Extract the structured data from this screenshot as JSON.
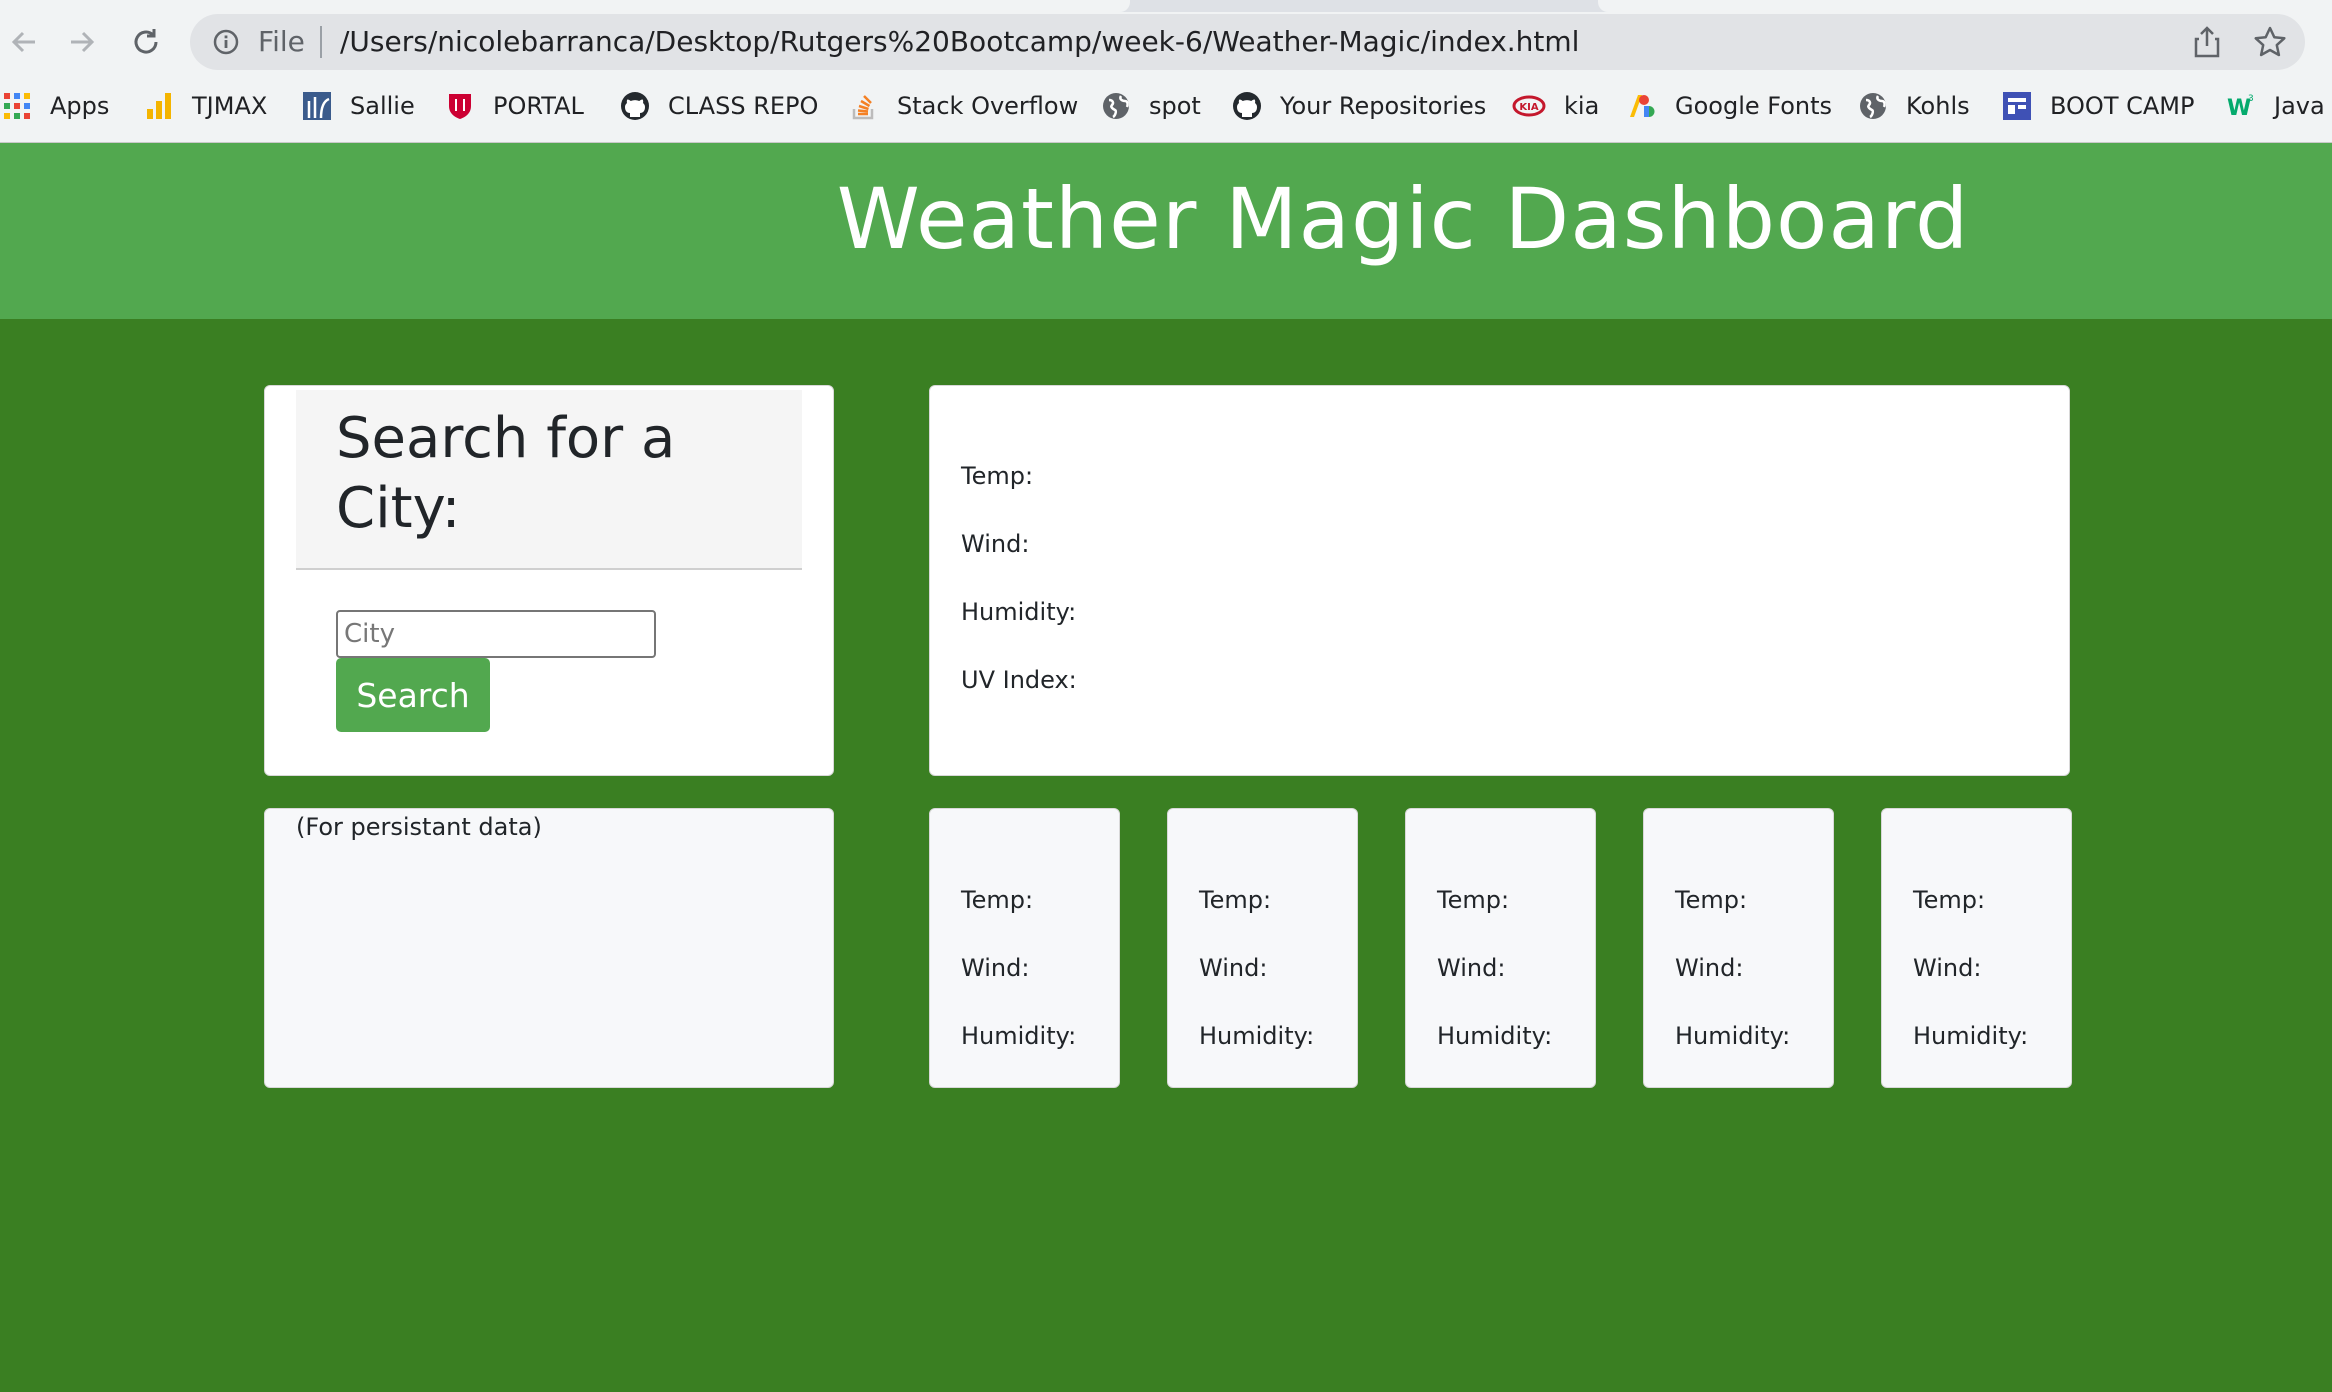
{
  "browser": {
    "file_label": "File",
    "url": "/Users/nicolebarranca/Desktop/Rutgers%20Bootcamp/week-6/Weather-Magic/index.html",
    "bookmarks": [
      {
        "label": "Apps",
        "icon": "apps-grid-icon"
      },
      {
        "label": "TJMAX",
        "icon": "bar-chart-icon"
      },
      {
        "label": "Sallie",
        "icon": "sallie-icon"
      },
      {
        "label": "PORTAL",
        "icon": "shield-icon"
      },
      {
        "label": "CLASS REPO",
        "icon": "github-icon"
      },
      {
        "label": "Stack Overflow",
        "icon": "stack-overflow-icon"
      },
      {
        "label": "spot",
        "icon": "globe-icon"
      },
      {
        "label": "Your Repositories",
        "icon": "github-icon"
      },
      {
        "label": "kia",
        "icon": "kia-icon"
      },
      {
        "label": "Google Fonts",
        "icon": "google-fonts-icon"
      },
      {
        "label": "Kohls",
        "icon": "globe-icon"
      },
      {
        "label": "BOOT CAMP",
        "icon": "bootcamp-icon"
      },
      {
        "label": "Java",
        "icon": "w3schools-icon"
      }
    ]
  },
  "page": {
    "title": "Weather Magic Dashboard",
    "search": {
      "heading": "Search for a City:",
      "placeholder": "City",
      "button_label": "Search"
    },
    "history": {
      "label": "(For persistant data)"
    },
    "current": {
      "temp_label": "Temp:",
      "wind_label": "Wind:",
      "humidity_label": "Humidity:",
      "uv_label": "UV Index:"
    },
    "forecast": [
      {
        "temp_label": "Temp:",
        "wind_label": "Wind:",
        "humidity_label": "Humidity:"
      },
      {
        "temp_label": "Temp:",
        "wind_label": "Wind:",
        "humidity_label": "Humidity:"
      },
      {
        "temp_label": "Temp:",
        "wind_label": "Wind:",
        "humidity_label": "Humidity:"
      },
      {
        "temp_label": "Temp:",
        "wind_label": "Wind:",
        "humidity_label": "Humidity:"
      },
      {
        "temp_label": "Temp:",
        "wind_label": "Wind:",
        "humidity_label": "Humidity:"
      }
    ]
  },
  "colors": {
    "header_green": "#52a84f",
    "page_green": "#3a7f22",
    "button_green": "#52a84f"
  }
}
